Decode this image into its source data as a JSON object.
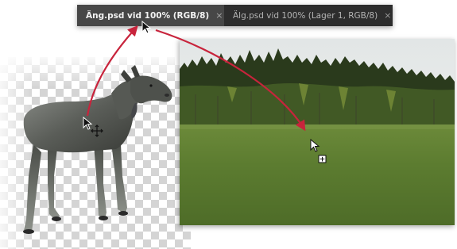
{
  "tabs": [
    {
      "label": "Äng.psd vid 100% (RGB/8)",
      "close": "×",
      "active": true
    },
    {
      "label": "Älg.psd vid 100% (Lager 1, RGB/8)",
      "close": "×",
      "active": false
    }
  ],
  "icons": {
    "tab_close": "close-icon",
    "cursor_top": "arrow-cursor-icon",
    "cursor_move": "move-cursor-icon",
    "cursor_drop": "copy-cursor-icon",
    "drop_badge": "+"
  },
  "colors": {
    "arrow": "#c8243c",
    "tabbar": "#2d2d2d",
    "tab_active": "#474747",
    "sky": "#eef0f0",
    "forest": "#2a3a1c",
    "grass": "#5a7a30"
  }
}
